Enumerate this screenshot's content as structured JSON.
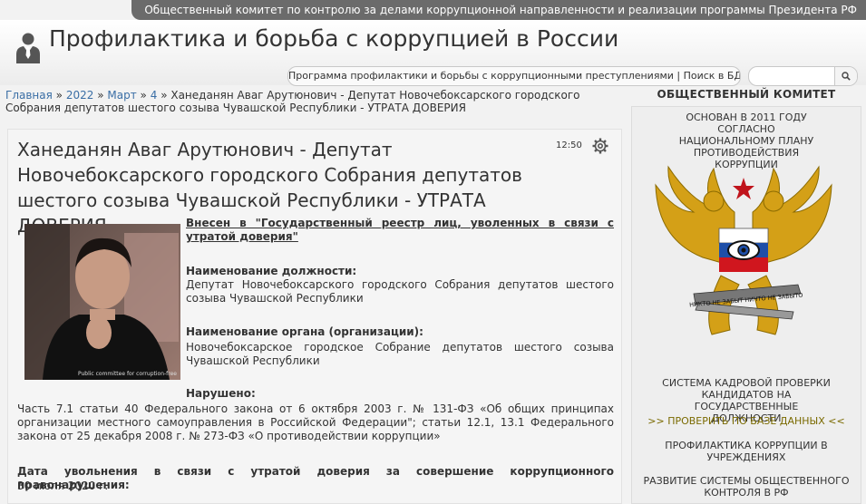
{
  "topbar": {
    "text": "Общественный комитет по контролю за делами коррупционной направленности и реализации программы Президента РФ"
  },
  "header": {
    "title": "Профилактика и борьба с коррупцией в России",
    "logo_icon": "person-tie-icon"
  },
  "nav": {
    "text": "Программа профилактики и борьбы с коррупционными преступлениями | Поиск в БД:"
  },
  "search": {
    "placeholder": "",
    "button_icon": "search-icon"
  },
  "breadcrumb": {
    "items": [
      "Главная",
      "2022",
      "Март",
      "4"
    ],
    "separator": "»",
    "current": "Ханеданян Аваг Арутюнович - Депутат Новочебоксарского городского Собрания депутатов шестого созыва Чувашской Республики - УТРАТА ДОВЕРИЯ"
  },
  "article": {
    "title": "Ханеданян Аваг Арутюнович - Депутат Новочебоксарского городского Собрания депутатов шестого созыва Чувашской Республики - УТРАТА ДОВЕРИЯ",
    "time": "12:50",
    "photo_caption": "Public committee for corruption-free",
    "registry_link": "Внесен в \"Государственный реестр лиц, уволенных в связи с утратой доверия\"",
    "position_label": "Наименование должности:",
    "position_value": "Депутат Новочебоксарского городского Собрания депутатов шестого созыва Чувашской Республики",
    "org_label": "Наименование органа (организации):",
    "org_value": "Новочебоксарское городское Собрание депутатов шестого созыва Чувашской Республики",
    "violation_label": "Нарушено:",
    "violation_value": "Часть 7.1 статьи 40 Федерального закона от 6 октября 2003 г. № 131-ФЗ «Об общих принципах организации местного самоуправления в Российской Федерации\"; статьи 12.1, 13.1 Федерального закона от 25 декабря 2008 г. № 273-ФЗ «О противодействии коррупции»",
    "dismissal_label": "Дата увольнения в связи с утратой доверия за совершение коррупционного правонарушения:",
    "dismissal_value": "30 июля 2020 г."
  },
  "sidebar": {
    "header": "ОБЩЕСТВЕННЫЙ КОМИТЕТ",
    "founded": "ОСНОВАН В 2011 ГОДУ СОГЛАСНО НАЦИОНАЛЬНОМУ ПЛАНУ ПРОТИВОДЕЙСТВИЯ КОРРУПЦИИ",
    "emblem_ribbon": "НИКТО НЕ ЗАБЫТ НИЧТО НЕ ЗАБЫТО",
    "system_title": "СИСТЕМА КАДРОВОЙ ПРОВЕРКИ КАНДИДАТОВ НА ГОСУДАРСТВЕННЫЕ ДОЛЖНОСТИ",
    "system_link": ">> ПРОВЕРИТЬ ПО БАЗЕ ДАННЫХ <<",
    "prevention": "ПРОФИЛАКТИКА КОРРУПЦИИ В УЧРЕЖДЕНИЯХ",
    "development": "РАЗВИТИЕ СИСТЕМЫ ОБЩЕСТВЕННОГО КОНТРОЛЯ В РФ"
  },
  "colors": {
    "topbar": "#6b6b6b",
    "link": "#3a6ea5",
    "sidebar_link": "#7a6a00"
  }
}
